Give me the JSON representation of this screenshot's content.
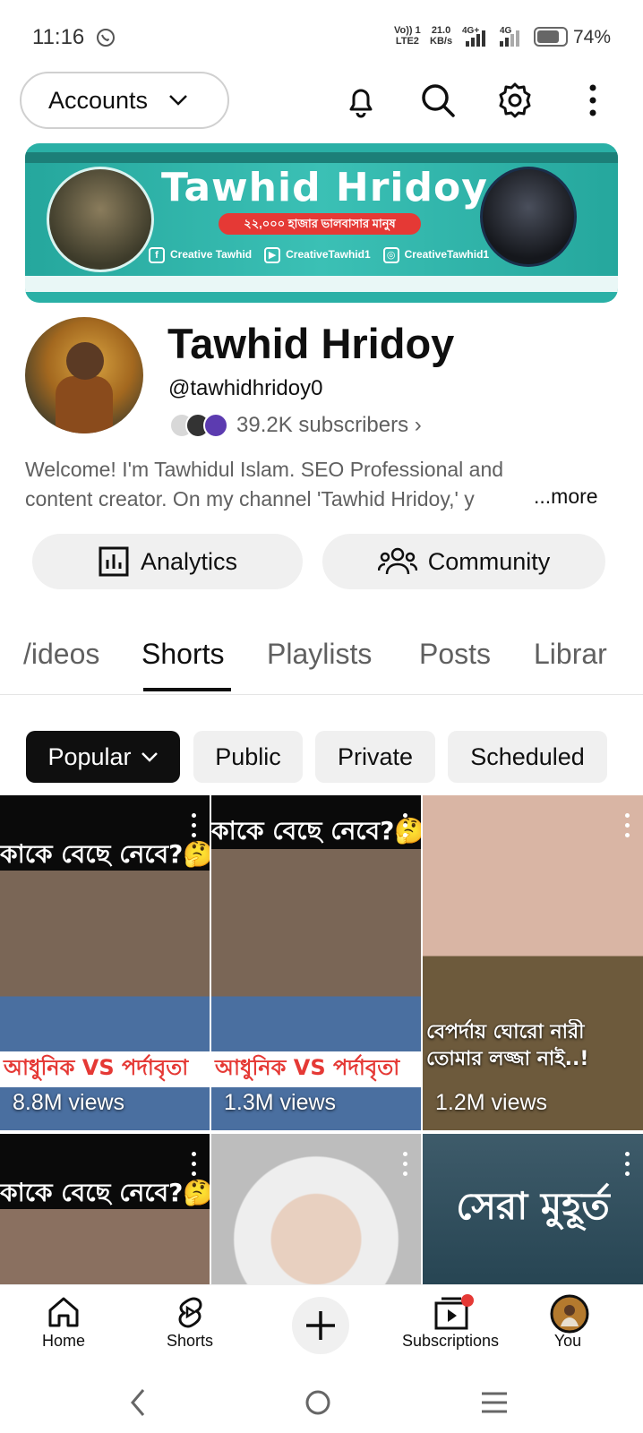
{
  "status_bar": {
    "time": "11:16",
    "network_top": "Vo)) 1",
    "network_bottom": "LTE2",
    "speed_top": "21.0",
    "speed_bottom": "KB/s",
    "sig1_label": "4G+",
    "sig2_label": "4G",
    "battery": "74%"
  },
  "top_bar": {
    "accounts_label": "Accounts"
  },
  "banner": {
    "title": "Tawhid Hridoy",
    "tagline": "২২,০০০ হাজার ভালবাসার মানুষ",
    "social_facebook": "Creative Tawhid",
    "social_youtube": "CreativeTawhid1",
    "social_instagram": "CreativeTawhid1"
  },
  "channel": {
    "name": "Tawhid Hridoy",
    "handle": "@tawhidhridoy0",
    "subscribers": "39.2K subscribers",
    "description_line1": "Welcome! I'm Tawhidul Islam. SEO Professional and",
    "description_line2": "content creator. On  my channel 'Tawhid Hridoy,' y",
    "more": "...more",
    "analytics_label": "Analytics",
    "community_label": "Community"
  },
  "tabs": [
    "Videos",
    "Shorts",
    "Playlists",
    "Posts",
    "Library"
  ],
  "tabs_display": [
    "/ideos",
    "Shorts",
    "Playlists",
    "Posts",
    "Librar"
  ],
  "active_tab": "Shorts",
  "chips": [
    "Popular",
    "Public",
    "Private",
    "Scheduled"
  ],
  "shorts": [
    {
      "title": "কাকে বেছে নেবে?🤔❤️",
      "bottom_text": "আধুনিক VS পর্দাবৃতা",
      "views": "8.8M views"
    },
    {
      "title": "কাকে বেছে নেবে?🤔❤️",
      "bottom_text": "আধুনিক VS পর্দাবৃতা",
      "views": "1.3M views"
    },
    {
      "title": "",
      "bottom_text": "বেপর্দায় ঘোরো নারী তোমার লজ্জা নাই..!",
      "views": "1.2M views"
    },
    {
      "title": "কাকে বেছে নেবে?🤔❤️",
      "bottom_text": "",
      "views": ""
    },
    {
      "title": "",
      "bottom_text": "",
      "views": ""
    },
    {
      "title": "সেরা মুহূর্ত",
      "bottom_text": "",
      "views": ""
    }
  ],
  "bottom_nav": {
    "home": "Home",
    "shorts": "Shorts",
    "subscriptions": "Subscriptions",
    "you": "You"
  },
  "colors": {
    "accent_red": "#e53935",
    "banner_teal": "#2ab0a6",
    "chip_selected": "#0f0f0f"
  }
}
